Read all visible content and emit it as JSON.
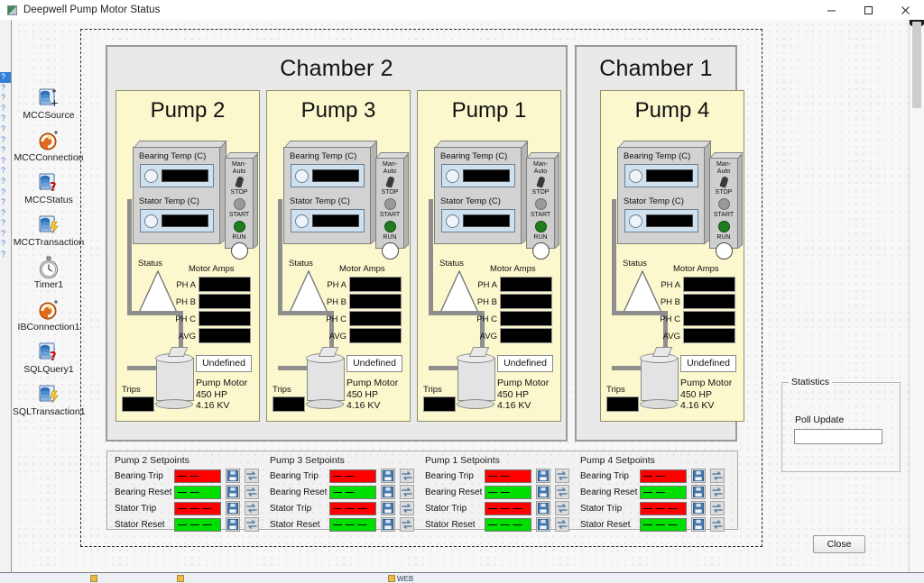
{
  "window": {
    "title": "Deepwell Pump Motor Status",
    "icon": "app-icon",
    "minimize": "minimize-icon",
    "maximize": "maximize-icon",
    "close": "close-icon"
  },
  "gutter": {
    "marks": [
      "?",
      "?",
      "?",
      "?",
      "?",
      "?",
      "?",
      "?",
      "?",
      "?",
      "?",
      "?",
      "?"
    ]
  },
  "component_tray": [
    {
      "label": "MCCSource",
      "icon": "database-add-icon"
    },
    {
      "label": "MCCConnection",
      "icon": "connection-icon"
    },
    {
      "label": "MCCStatus",
      "icon": "database-query-icon"
    },
    {
      "label": "MCCTransaction",
      "icon": "database-transaction-icon"
    },
    {
      "label": "Timer1",
      "icon": "timer-icon"
    },
    {
      "label": "IBConnection1",
      "icon": "connection-icon"
    },
    {
      "label": "SQLQuery1",
      "icon": "database-query-icon"
    },
    {
      "label": "SQLTransaction1",
      "icon": "database-transaction-icon"
    }
  ],
  "chambers": [
    {
      "title": "Chamber 2"
    },
    {
      "title": "Chamber 1"
    }
  ],
  "pump_labels": {
    "bearing_temp": "Bearing Temp (C)",
    "stator_temp": "Stator Temp (C)",
    "man_auto": "Man-Auto",
    "stop": "STOP",
    "start": "START",
    "run": "RUN",
    "status": "Status",
    "motor_amps": "Motor Amps",
    "ph_a": "PH A",
    "ph_b": "PH B",
    "ph_c": "PH C",
    "avg": "AVG",
    "trips": "Trips",
    "undefined_state": "Undefined",
    "motor_line1": "Pump Motor",
    "motor_line2": "450 HP",
    "motor_line3": "4.16 KV"
  },
  "pumps": [
    {
      "title": "Pump 2",
      "bearing_temp": "",
      "stator_temp": "",
      "ph_a": "",
      "ph_b": "",
      "ph_c": "",
      "avg": "",
      "trips": "",
      "state": "Undefined"
    },
    {
      "title": "Pump 3",
      "bearing_temp": "",
      "stator_temp": "",
      "ph_a": "",
      "ph_b": "",
      "ph_c": "",
      "avg": "",
      "trips": "",
      "state": "Undefined"
    },
    {
      "title": "Pump 1",
      "bearing_temp": "",
      "stator_temp": "",
      "ph_a": "",
      "ph_b": "",
      "ph_c": "",
      "avg": "",
      "trips": "",
      "state": "Undefined"
    },
    {
      "title": "Pump 4",
      "bearing_temp": "",
      "stator_temp": "",
      "ph_a": "",
      "ph_b": "",
      "ph_c": "",
      "avg": "",
      "trips": "",
      "state": "Undefined"
    }
  ],
  "setpoints": {
    "row_labels": [
      "Bearing  Trip",
      "Bearing Reset",
      "Stator Trip",
      "Stator Reset"
    ],
    "save_icon": "save-icon",
    "refresh_icon": "refresh-icon",
    "groups": [
      {
        "title": "Pump 2 Setpoints",
        "values": [
          "— —",
          "— —",
          "— — —",
          "— — —"
        ]
      },
      {
        "title": "Pump 3 Setpoints",
        "values": [
          "— —",
          "— —",
          "— — —",
          "— — —"
        ]
      },
      {
        "title": "Pump 1 Setpoints",
        "values": [
          "— —",
          "— —",
          "— — —",
          "— — —"
        ]
      },
      {
        "title": "Pump 4 Setpoints",
        "values": [
          "— —",
          "— —",
          "— — —",
          "— — —"
        ]
      }
    ]
  },
  "statistics": {
    "title": "Statistics",
    "poll_update_label": "Poll Update",
    "poll_update_value": ""
  },
  "close_button": "Close",
  "taskbar": [
    {
      "label": ""
    },
    {
      "label": ""
    },
    {
      "label": "WEB"
    }
  ],
  "colors": {
    "panel_yellow": "#fbf8cd",
    "chamber_gray": "#e9e9e9",
    "trip_red": "#ff0000",
    "reset_green": "#00e000",
    "lcd_black": "#000000",
    "run_led_green": "#1f7d1f",
    "stop_led_gray": "#9a9a9a"
  }
}
